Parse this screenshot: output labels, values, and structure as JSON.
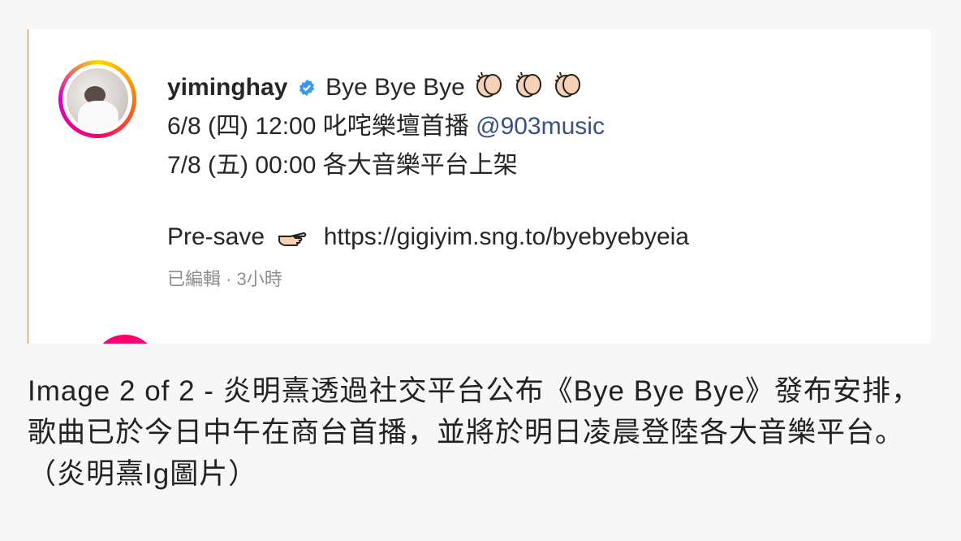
{
  "post": {
    "username": "yiminghay",
    "verified_icon": "verified-badge-icon",
    "title": "Bye Bye Bye",
    "title_emojis": [
      "clapping-hands-icon",
      "clapping-hands-icon",
      "clapping-hands-icon"
    ],
    "line2_text": "6/8 (四) 12:00 叱咤樂壇首播",
    "line2_mention": "@903music",
    "line3": "7/8 (五) 00:00 各大音樂平台上架",
    "presave_label": "Pre-save",
    "presave_icon": "pointing-hand-icon",
    "presave_link": "https://gigiyim.sng.to/byebyebyeia",
    "meta": "已編輯 · 3小時"
  },
  "caption": {
    "text": "Image 2 of 2 - 炎明熹透過社交平台公布《Bye Bye Bye》發布安排，歌曲已於今日中午在商台首播，並將於明日凌晨登陸各大音樂平台。（炎明熹Ig圖片）"
  },
  "colors": {
    "mention": "#385185",
    "verified": "#3897f0",
    "meta": "#8e8e8e"
  }
}
